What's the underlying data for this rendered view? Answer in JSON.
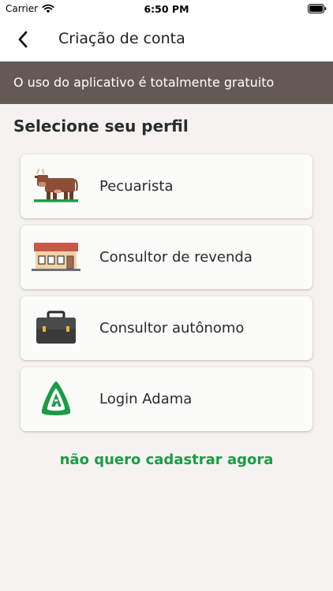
{
  "status_bar": {
    "carrier": "Carrier",
    "time": "6:50 PM"
  },
  "nav": {
    "title": "Criação de conta",
    "back_icon": "chevron-left-icon"
  },
  "banner": {
    "text": "O uso do aplicativo é totalmente gratuito",
    "color": "#655a53"
  },
  "section_title": "Selecione seu perfil",
  "profiles": [
    {
      "label": "Pecuarista",
      "icon": "cow-icon"
    },
    {
      "label": "Consultor de revenda",
      "icon": "store-icon"
    },
    {
      "label": "Consultor autônomo",
      "icon": "briefcase-icon"
    },
    {
      "label": "Login Adama",
      "icon": "adama-logo-icon"
    }
  ],
  "skip_link": {
    "text": "não quero cadastrar agora",
    "color": "#1f9a47"
  }
}
